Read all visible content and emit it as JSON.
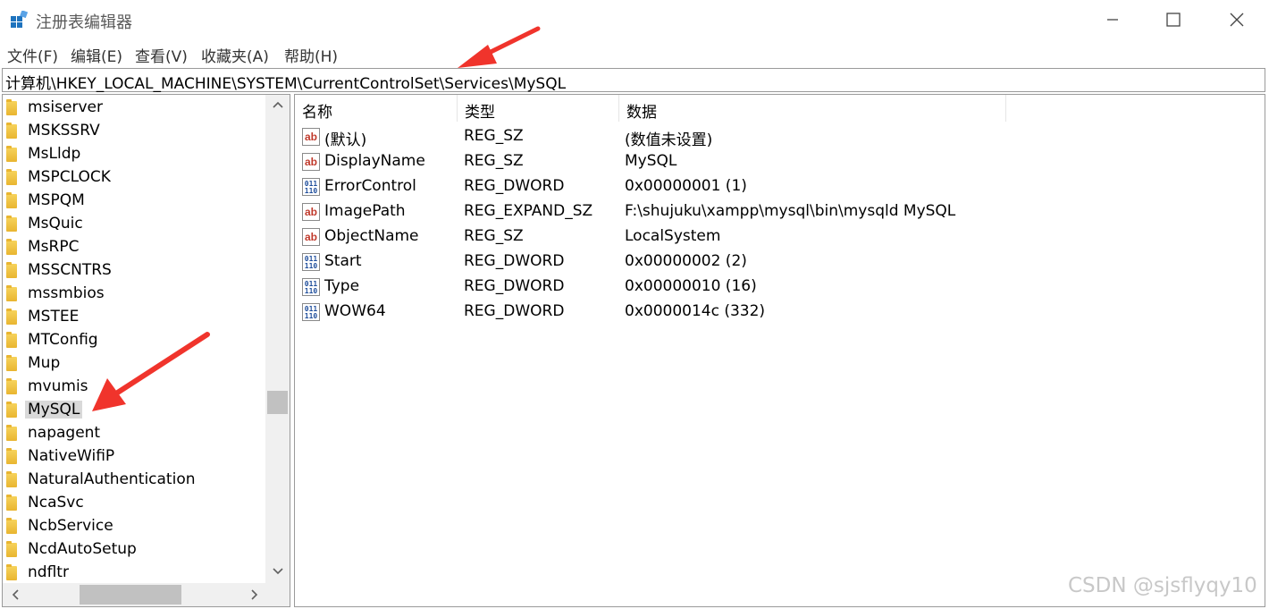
{
  "window": {
    "title": "注册表编辑器",
    "minimize_glyph": "—",
    "maximize_glyph": "☐",
    "close_glyph": "✕"
  },
  "menu": [
    "文件(F)",
    "编辑(E)",
    "查看(V)",
    "收藏夹(A)",
    "帮助(H)"
  ],
  "address": "计算机\\HKEY_LOCAL_MACHINE\\SYSTEM\\CurrentControlSet\\Services\\MySQL",
  "tree": {
    "items": [
      "msiserver",
      "MSKSSRV",
      "MsLldp",
      "MSPCLOCK",
      "MSPQM",
      "MsQuic",
      "MsRPC",
      "MSSCNTRS",
      "mssmbios",
      "MSTEE",
      "MTConfig",
      "Mup",
      "mvumis",
      "MySQL",
      "napagent",
      "NativeWifiP",
      "NaturalAuthentication",
      "NcaSvc",
      "NcbService",
      "NcdAutoSetup",
      "ndfltr"
    ],
    "selected": "MySQL"
  },
  "values_table": {
    "headers": [
      "名称",
      "类型",
      "数据"
    ],
    "rows": [
      {
        "icon": "string-value-icon",
        "name": "(默认)",
        "type": "REG_SZ",
        "data": "(数值未设置)"
      },
      {
        "icon": "string-value-icon",
        "name": "DisplayName",
        "type": "REG_SZ",
        "data": "MySQL"
      },
      {
        "icon": "binary-value-icon",
        "name": "ErrorControl",
        "type": "REG_DWORD",
        "data": "0x00000001 (1)"
      },
      {
        "icon": "string-value-icon",
        "name": "ImagePath",
        "type": "REG_EXPAND_SZ",
        "data": "F:\\shujuku\\xampp\\mysql\\bin\\mysqld MySQL"
      },
      {
        "icon": "string-value-icon",
        "name": "ObjectName",
        "type": "REG_SZ",
        "data": "LocalSystem"
      },
      {
        "icon": "binary-value-icon",
        "name": "Start",
        "type": "REG_DWORD",
        "data": "0x00000002 (2)"
      },
      {
        "icon": "binary-value-icon",
        "name": "Type",
        "type": "REG_DWORD",
        "data": "0x00000010 (16)"
      },
      {
        "icon": "binary-value-icon",
        "name": "WOW64",
        "type": "REG_DWORD",
        "data": "0x0000014c (332)"
      }
    ]
  },
  "string_icon_text": "ab",
  "binary_icon_text": "011\n110",
  "watermark": "CSDN @sjsflyqy10",
  "colors": {
    "annotation_arrow": "#f0342c",
    "selection": "#d9d9d9",
    "folder": "#f2c440"
  }
}
